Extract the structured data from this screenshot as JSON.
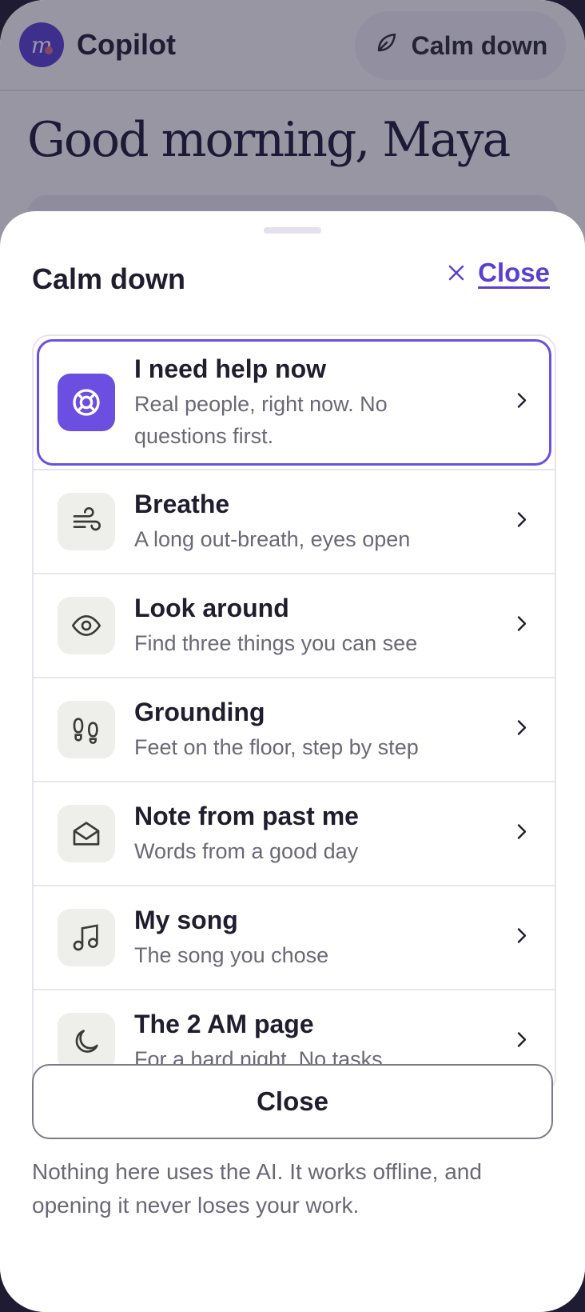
{
  "app": {
    "name": "Copilot",
    "logo_letter": "m"
  },
  "header": {
    "calm_button": "Calm down"
  },
  "greeting": "Good morning, Maya",
  "sheet": {
    "title": "Calm down",
    "close_link": "Close",
    "items": [
      {
        "title": "I need help now",
        "subtitle": "Real people, right now. No questions first.",
        "icon": "lifebuoy-icon",
        "highlighted": true
      },
      {
        "title": "Breathe",
        "subtitle": "A long out-breath, eyes open",
        "icon": "wind-icon"
      },
      {
        "title": "Look around",
        "subtitle": "Find three things you can see",
        "icon": "eye-icon"
      },
      {
        "title": "Grounding",
        "subtitle": "Feet on the floor, step by step",
        "icon": "footprints-icon"
      },
      {
        "title": "Note from past me",
        "subtitle": "Words from a good day",
        "icon": "envelope-open-icon"
      },
      {
        "title": "My song",
        "subtitle": "The song you chose",
        "icon": "music-note-icon"
      },
      {
        "title": "The 2 AM page",
        "subtitle": "For a hard night. No tasks.",
        "icon": "moon-icon"
      }
    ],
    "close_button": "Close",
    "footer_note": "Nothing here uses the AI. It works offline, and opening it never loses your work."
  },
  "colors": {
    "accent": "#6a4fe0",
    "scrim": "#201c3c",
    "icon_tile": "#eeeeea"
  }
}
